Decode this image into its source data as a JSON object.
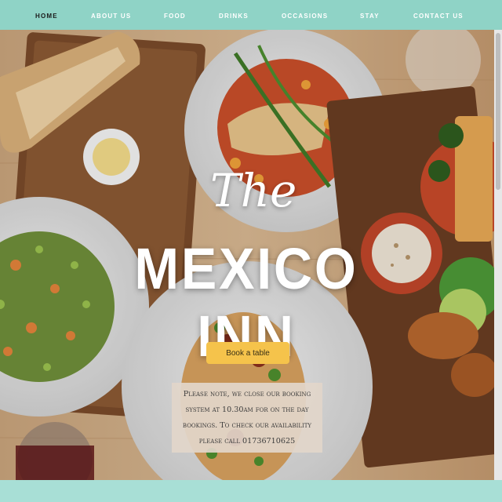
{
  "nav": {
    "items": [
      {
        "label": "HOME",
        "active": true
      },
      {
        "label": "ABOUT US",
        "active": false
      },
      {
        "label": "FOOD",
        "active": false
      },
      {
        "label": "DRINKS",
        "active": false
      },
      {
        "label": "OCCASIONS",
        "active": false
      },
      {
        "label": "STAY",
        "active": false
      },
      {
        "label": "CONTACT US",
        "active": false
      }
    ]
  },
  "hero": {
    "title_prefix": "The",
    "title": "MEXICO INN",
    "book_button": "Book a table",
    "notice": "Please note, we close our booking system at 10.30am for on the day bookings. To check our availability please call 01736710625"
  },
  "colors": {
    "nav_bg": "#8fd3c6",
    "nav_active_text": "#1a1a1a",
    "button_bg": "#f5c34b",
    "footer_strip": "#a8dfd6"
  }
}
